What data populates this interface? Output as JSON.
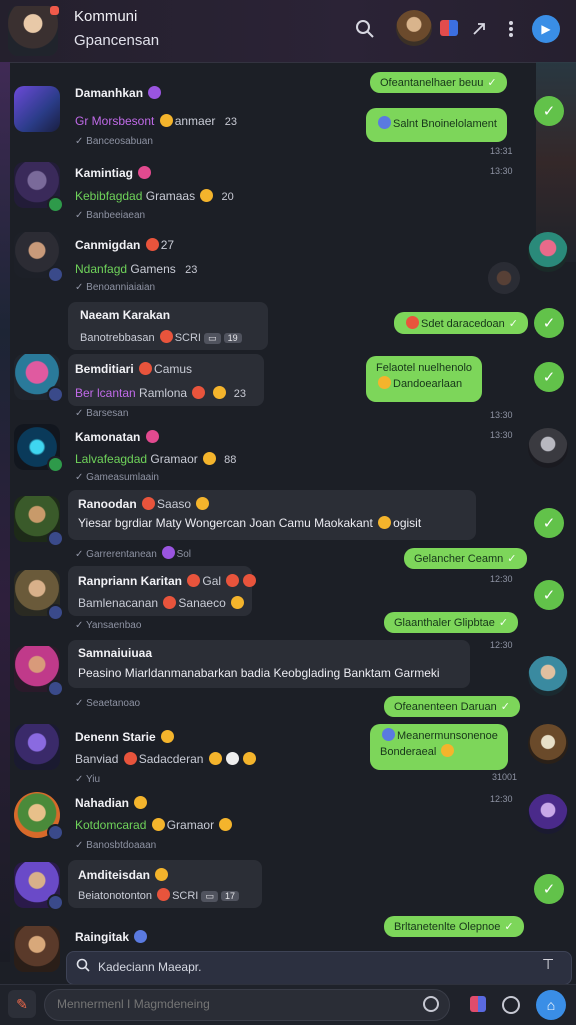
{
  "header": {
    "title": "Kommuni",
    "subtitle": "Gpancensan",
    "search_icon": "search-icon",
    "menu_icon": "more-vertical-icon",
    "send_icon": "paper-plane-icon"
  },
  "chats": [
    {
      "name": "Damanhkan",
      "preview": "Gr Morsbesont",
      "preview_tail": "anmaer",
      "count": "23",
      "meta": "Banceosabuan"
    },
    {
      "name": "Kamintiag",
      "preview": "Kebibfagdad",
      "preview_tail": "Gramaas",
      "count": "20",
      "meta": "Banbeeiaean"
    },
    {
      "name": "Canmigdan",
      "name_tail": "27",
      "preview": "Ndanfagd",
      "preview_tail": "Gamens",
      "count": "23",
      "meta": "Benoanniaiaian"
    },
    {
      "name": "Naeam Karakan",
      "preview": "Banotrebbasan",
      "preview_tail": "SCRI",
      "count": "19"
    },
    {
      "name": "Bemditiari",
      "name_tail": "Camus",
      "preview": "Ber lcantan",
      "preview_tail": "Ramlona",
      "count": "23",
      "meta": "Barsesan"
    },
    {
      "name": "Kamonatan",
      "preview": "Lalvafeagdad",
      "preview_tail": "Gramaor",
      "count": "88",
      "meta": "Gameasumlaain"
    },
    {
      "name": "Ranoodan",
      "name_tail": "Saaso",
      "preview": "Yiesar bgrdiar Maty Wongercan Joan Camu Maokakant",
      "preview_tail": "ogisit",
      "meta": "Garrerentanean",
      "meta_tail": "Sol"
    },
    {
      "name": "Ranpriann Karitan",
      "name_tail": "Gal",
      "preview": "Bamlenacanan",
      "preview_tail": "Sanaeco",
      "meta": "Yansaenbao"
    },
    {
      "name": "Samnaiuiuaa",
      "preview": "Peasino Miarldanmanabarkan badia Keobglading Banktam Garmeki",
      "meta": "Seaetanoao"
    },
    {
      "name": "Denenn Starie",
      "preview": "Banviad",
      "preview_tail": "Sadacderan",
      "meta": "Yiu"
    },
    {
      "name": "Nahadian",
      "preview": "Kotdomcarad",
      "preview_tail": "Gramaor",
      "meta": "Banosbtdoaaan"
    },
    {
      "name": "Amditeisdan",
      "preview": "Beiatonotonton",
      "preview_tail": "SCRI",
      "count": "17"
    },
    {
      "name": "Raingitak"
    }
  ],
  "outgoing": [
    {
      "text": "Ofeantanelhaer beuu"
    },
    {
      "text": "Salnt Bnoinelolament",
      "time": "13:31"
    },
    {
      "time": "13:30"
    },
    {
      "text": "Sdet daracedoan"
    },
    {
      "text": "Felaotel nuelhenolo",
      "text2": "Dandoearlaan",
      "time": "13:30"
    },
    {
      "time": "13:30"
    },
    {
      "text": "Gelancher Ceamn",
      "time": "12:30"
    },
    {
      "text": "Glaanthaler Glipbtae",
      "time": "12:30"
    },
    {
      "text": "Ofeanenteen Daruan"
    },
    {
      "text": "Meanermunsonenoe",
      "text2": "Bonderaeal",
      "time": "31001"
    },
    {
      "time": "12:30"
    },
    {
      "text": "Brltanetenlte Olepnoe"
    }
  ],
  "search": {
    "placeholder": "Kadeciann Maeapr."
  },
  "composer": {
    "placeholder": "Mennermenl I Magmdeneing"
  },
  "colors": {
    "accent": "#3a8ee6",
    "outgoing_bubble": "#7dd65a",
    "preview_green": "#6fd35a",
    "preview_purple": "#c06ae8",
    "background": "#1c1f26"
  }
}
